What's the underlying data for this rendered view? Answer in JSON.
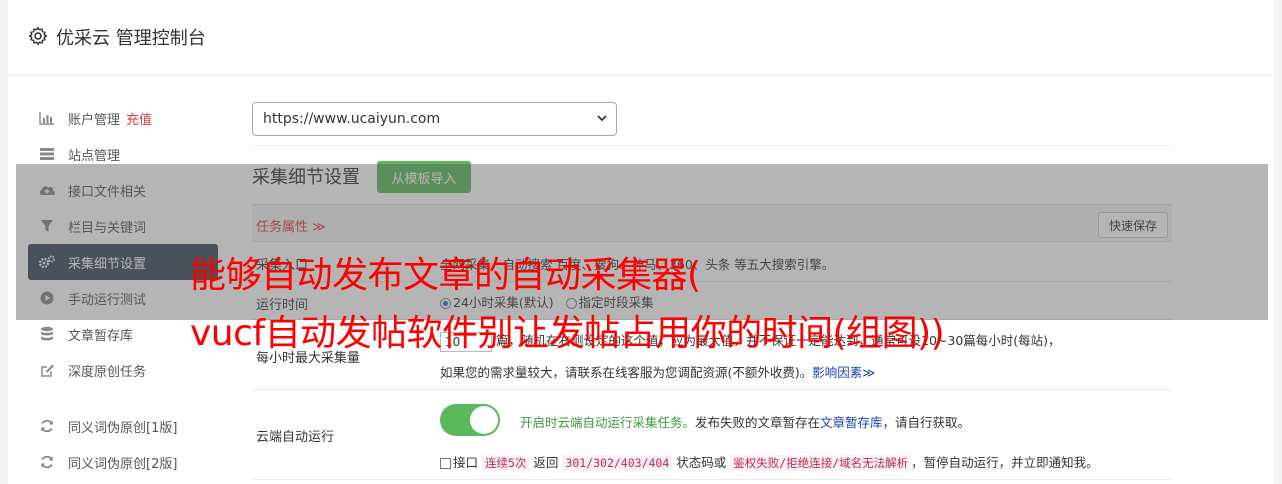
{
  "header": {
    "title": "优采云 管理控制台",
    "icon": "gear-icon"
  },
  "sidebar": {
    "items": [
      {
        "label": "账户管理",
        "extra": "充值",
        "icon": "bar-chart-icon"
      },
      {
        "label": "站点管理",
        "icon": "server-icon"
      },
      {
        "label": "接口文件相关",
        "icon": "cloud-upload-icon"
      },
      {
        "label": "栏目与关键词",
        "icon": "filter-icon"
      },
      {
        "label": "采集细节设置",
        "icon": "gears-icon",
        "active": true
      },
      {
        "label": "手动运行测试",
        "icon": "play-circle-icon"
      },
      {
        "label": "文章暂存库",
        "icon": "database-icon"
      },
      {
        "label": "深度原创任务",
        "icon": "edit-icon"
      },
      {
        "label": "同义词伪原创[1版]",
        "icon": "refresh-icon"
      },
      {
        "label": "同义词伪原创[2版]",
        "icon": "refresh-icon"
      }
    ]
  },
  "site_select": {
    "value": "https://www.ucaiyun.com"
  },
  "section": {
    "title": "采集细节设置",
    "import_button": "从模板导入"
  },
  "task_bar": {
    "label": "任务属性 ≫",
    "quick_save": "快速保存"
  },
  "rows": {
    "collect_label": "采集入口",
    "collect_text": "全网采集，自动搜索 百度、搜狗、神马、360、头条 等五大搜索引擎。",
    "run_time_label": "运行时间",
    "run_opt1": "24小时采集(默认)",
    "run_opt2": "指定时段采集",
    "max_label": "每小时最大采集量",
    "max_value": "10",
    "max_text": "篇，随机在右侧设定的这个值，应为最大值，并不保证一定能达到，通常可设10~30篇每小时(每站)，",
    "max_text2_a": "如果您的需求量较大，请联系在线客服为您调配资源(不额外收费)。",
    "max_text2_link": "影响因素≫",
    "cloud_label": "云端自动运行",
    "cloud_text_green": "开启时云端自动运行采集任务。",
    "cloud_text_mid": "发布失败的文章暂存在",
    "cloud_text_link": "文章暂存库",
    "cloud_text_end": "，请自行获取。",
    "fail_a": "接口",
    "fail_code1": "连续5次",
    "fail_b": "返回",
    "fail_code2": "301/302/403/404",
    "fail_c": "状态码或",
    "fail_code3": "鉴权失败/拒绝连接/域名无法解析",
    "fail_d": "，暂停自动运行，并立即通知我。"
  },
  "overlay": {
    "line1": "能够自动发布文章的自动采集器(",
    "line2": "vucf自动发帖软件别让发帖占用你的时间(组图))"
  },
  "colors": {
    "accent_green": "#5cb85c",
    "active_sidebar": "#3e4a5a",
    "overlay_text": "#ff0000"
  }
}
